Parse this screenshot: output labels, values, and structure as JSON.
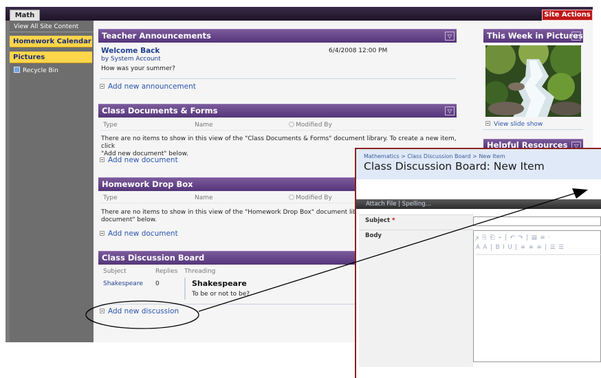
{
  "topbar": {
    "site_tab": "Math",
    "site_actions": "Site Actions ▾"
  },
  "leftnav": {
    "view_all": "View All Site Content",
    "items": [
      "Homework Calendar",
      "Pictures"
    ],
    "recycle_bin": "Recycle Bin"
  },
  "announcements": {
    "title": "Teacher Announcements",
    "item_title": "Welcome Back",
    "item_date": "6/4/2008 12:00 PM",
    "item_by": "by System Account",
    "item_body": "How was your summer?",
    "add_link": "Add new announcement"
  },
  "class_docs": {
    "title": "Class Documents & Forms",
    "columns": [
      "Type",
      "Name",
      "Modified By"
    ],
    "empty_line1": "There are no items to show in this view of the \"Class Documents & Forms\" document library. To create a new item, click",
    "empty_line2": "\"Add new document\" below.",
    "add_link": "Add new document"
  },
  "homework": {
    "title": "Homework Drop Box",
    "columns": [
      "Type",
      "Name",
      "Modified By"
    ],
    "empty_line1": "There are no items to show in this view of the \"Homework Drop Box\" document library. To",
    "empty_line2": "document\" below.",
    "add_link": "Add new document"
  },
  "discussion": {
    "title": "Class Discussion Board",
    "columns": [
      "Subject",
      "Replies",
      "Threading"
    ],
    "row": {
      "subject": "Shakespeare",
      "replies": "0",
      "thread_title": "Shakespeare",
      "thread_body": "To be or not to be?"
    },
    "add_link": "Add new discussion"
  },
  "right": {
    "pictures_title": "This Week in Pictures",
    "slideshow_link": "View slide show",
    "resources_title": "Helpful Resources"
  },
  "popup": {
    "breadcrumb": "Mathematics > Class Discussion Board > New Item",
    "title": "Class Discussion Board: New Item",
    "toolbar": "Attach File  |  Spelling...",
    "subject_label": "Subject",
    "required_mark": "*",
    "body_label": "Body",
    "rte_row1": "ꭗ ⎘ ⎗ ⌁ | ↶ ↷ | ▤ ≡ ·",
    "rte_row2": "A A | B I U | ≡ ≡ ≡ | ☰ ☰"
  },
  "colors": {
    "purple_header": "#55357a",
    "nav_highlight": "#ffd54a",
    "site_actions": "#c01818",
    "link": "#2b55b0"
  }
}
